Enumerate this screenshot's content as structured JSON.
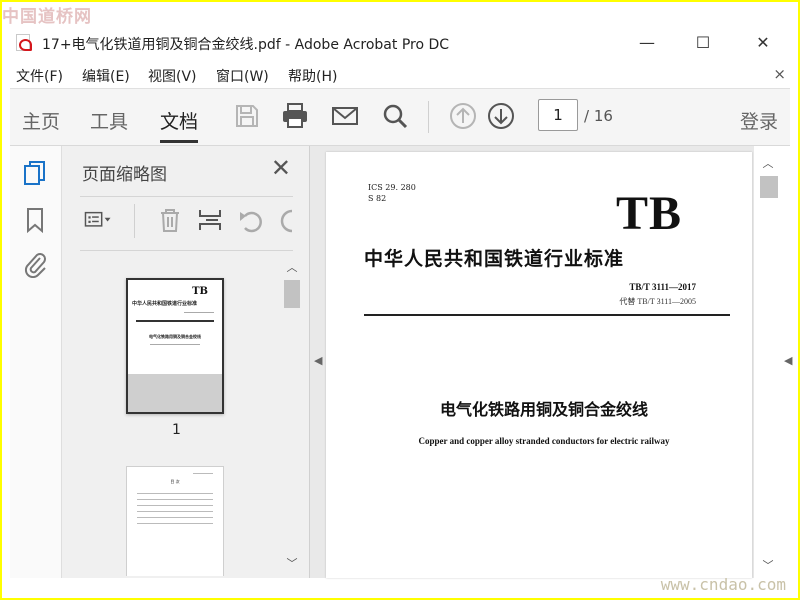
{
  "watermark": {
    "top": "中国道桥网",
    "bottom": "www.cndao.com"
  },
  "window": {
    "title": "17+电气化铁道用铜及铜合金绞线.pdf - Adobe Acrobat Pro DC",
    "minimize_glyph": "—",
    "maximize_glyph": "☐",
    "close_glyph": "✕"
  },
  "menu": {
    "items": [
      "文件(F)",
      "编辑(E)",
      "视图(V)",
      "窗口(W)",
      "帮助(H)"
    ],
    "close_glyph": "×"
  },
  "toolbar": {
    "tabs": [
      "主页",
      "工具",
      "文档"
    ],
    "active_tab": "文档",
    "icons": [
      "save-icon",
      "print-icon",
      "mail-icon",
      "search-icon",
      "page-up-icon",
      "page-down-icon"
    ],
    "current_page": "1",
    "total_pages": "/ 16",
    "login_label": "登录"
  },
  "left_strip": {
    "icons": [
      "pages-icon",
      "bookmark-icon",
      "attachment-icon"
    ]
  },
  "thumbnails_panel": {
    "title": "页面缩略图",
    "close_glyph": "✕",
    "tools": [
      "options-icon",
      "delete-icon",
      "insert-icon",
      "undo-icon",
      "redo-icon"
    ],
    "thumbs": [
      {
        "page_label": "1",
        "tb": "TB",
        "title": "中华人民共和国铁道行业标准",
        "doc_title": "电气化铁路用铜及铜合金绞线"
      },
      {
        "page_label": "",
        "title": "目 次"
      }
    ]
  },
  "document": {
    "ics": "ICS 29. 280",
    "class_code": "S 82",
    "brand": "TB",
    "standard_title": "中华人民共和国铁道行业标准",
    "standard_code": "TB/T 3111—2017",
    "replaces": "代替 TB/T 3111—2005",
    "title_cn": "电气化铁路用铜及铜合金绞线",
    "title_en": "Copper and copper alloy stranded conductors for electric railway"
  },
  "colors": {
    "accent": "#1a73c8",
    "frame": "#ffff00",
    "icon_gray": "#555555"
  }
}
